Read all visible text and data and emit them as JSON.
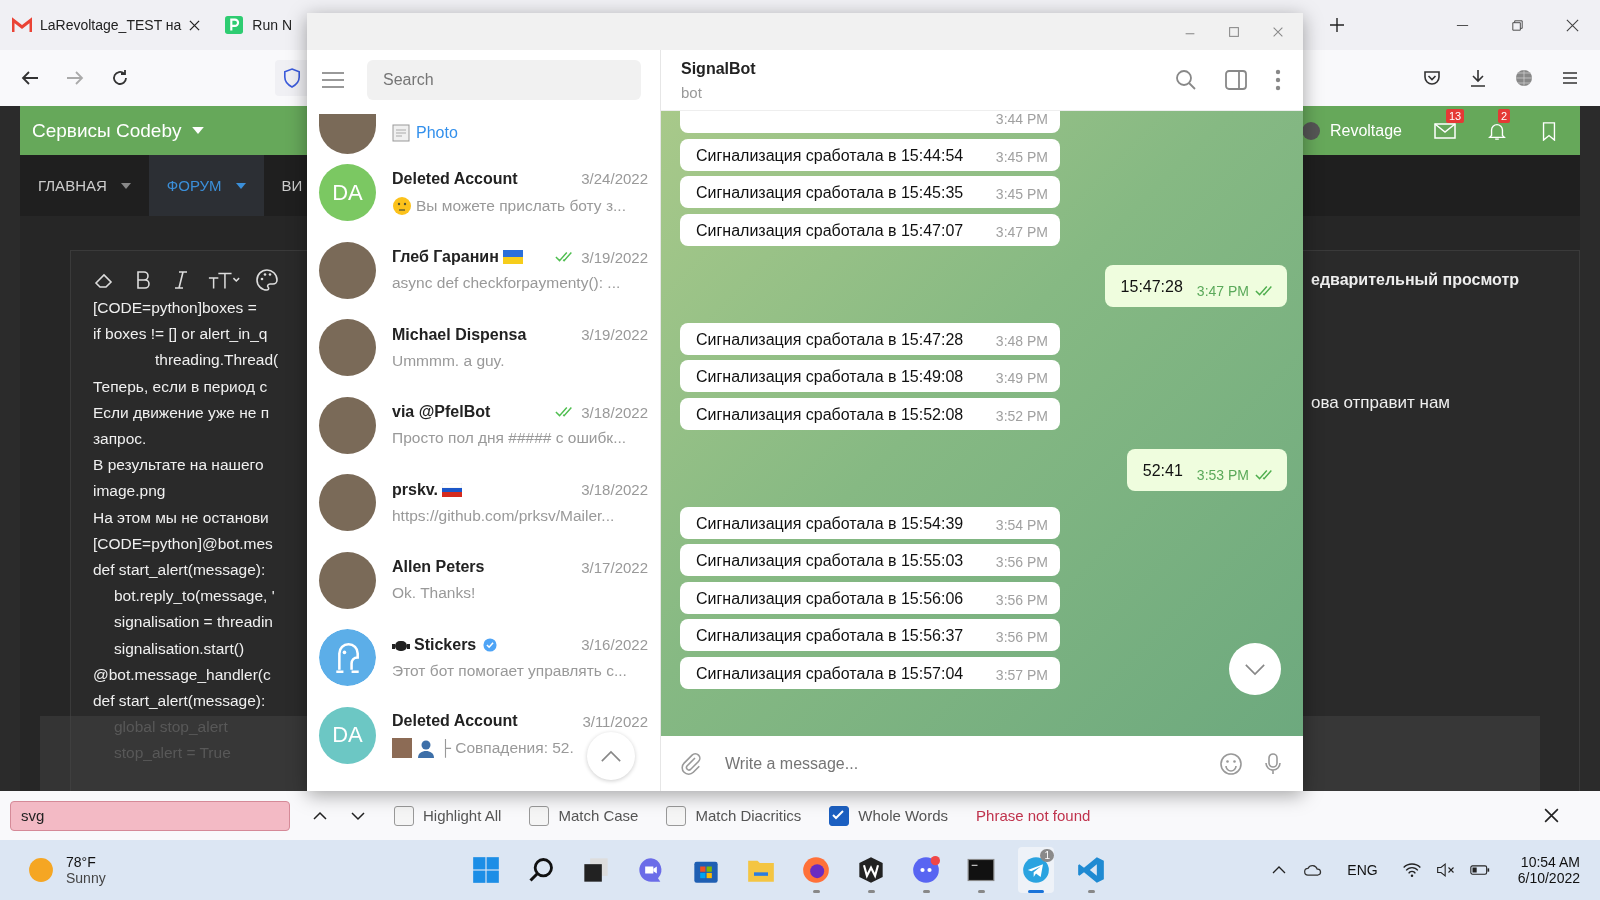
{
  "browser": {
    "tabs": [
      {
        "title": "LaRevoltage_TEST на",
        "kind": "mail"
      },
      {
        "title": "Run N",
        "kind": "p"
      }
    ]
  },
  "forum": {
    "menu_title": "Сервисы Codeby",
    "user": "Revoltage",
    "mail_badge": "13",
    "alert_badge": "2",
    "nav": [
      {
        "label": "ГЛАВНАЯ",
        "selected": false,
        "caret": true
      },
      {
        "label": "ФОРУМ",
        "selected": true,
        "caret": true
      },
      {
        "label": "ВИ",
        "selected": false,
        "caret": false
      }
    ],
    "editor_lines": [
      {
        "text": "[CODE=python]boxes =",
        "kind": "line"
      },
      {
        "text": "if boxes != [] or alert_in_q",
        "kind": "line"
      },
      {
        "text": "threading.Thread(",
        "kind": "deep"
      },
      {
        "text": "Теперь, если в период с",
        "kind": "line"
      },
      {
        "text": "Если движение уже не п",
        "kind": "line"
      },
      {
        "text": "запрос.",
        "kind": "line"
      },
      {
        "text": "В результате на нашего",
        "kind": "line"
      },
      {
        "text": "image.png",
        "kind": "line"
      },
      {
        "text": "На этом мы не останови",
        "kind": "line"
      },
      {
        "text": "[CODE=python]@bot.mes",
        "kind": "line"
      },
      {
        "text": "def start_alert(message):",
        "kind": "line"
      },
      {
        "text": "bot.reply_to(message, '",
        "kind": "indent"
      },
      {
        "text": "signalisation = threadin",
        "kind": "indent"
      },
      {
        "text": "signalisation.start()",
        "kind": "indent"
      },
      {
        "text": "@bot.message_handler(c",
        "kind": "line"
      },
      {
        "text": "def start_alert(message):",
        "kind": "line"
      },
      {
        "text": "global stop_alert",
        "kind": "faded"
      },
      {
        "text": "stop_alert = True",
        "kind": "faded"
      }
    ],
    "preview_label": "едварительный просмотр",
    "side_text": "ова отправит нам"
  },
  "telegram": {
    "search": {
      "placeholder": "Search"
    },
    "chats": [
      {
        "kind": "partial",
        "preview": "Photo",
        "avatar": {
          "kind": "photo"
        }
      },
      {
        "kind": "full",
        "name": "Deleted Account",
        "date": "3/24/2022",
        "preview": "Вы можете прислать боту з...",
        "preview_icon": {
          "kind": "emoji"
        },
        "read": false,
        "avatar": {
          "kind": "initials",
          "initials": "DA",
          "color": "#7bc862"
        }
      },
      {
        "kind": "full",
        "name": "Глеб Гаранин",
        "date": "3/19/2022",
        "preview": "async def checkforpaymenty():   ...",
        "read": true,
        "badge": {
          "kind": "ua"
        },
        "avatar": {
          "kind": "photo"
        }
      },
      {
        "kind": "full",
        "name": "Michael Dispensa",
        "date": "3/19/2022",
        "preview": "Ummmm.  a guy.",
        "read": false,
        "avatar": {
          "kind": "photo"
        }
      },
      {
        "kind": "full",
        "name": "via @PfelBot",
        "date": "3/18/2022",
        "preview": "Просто пол дня ##### с ошибк...",
        "read": true,
        "avatar": {
          "kind": "photo"
        }
      },
      {
        "kind": "full",
        "name": "prskv.",
        "date": "3/18/2022",
        "preview": "https://github.com/prksv/Mailer...",
        "read": false,
        "badge": {
          "kind": "ru"
        },
        "avatar": {
          "kind": "photo"
        }
      },
      {
        "kind": "full",
        "name": "Allen Peters",
        "date": "3/17/2022",
        "preview": "Ok.  Thanks!",
        "read": false,
        "avatar": {
          "kind": "photo"
        }
      },
      {
        "kind": "full",
        "name": "Stickers",
        "date": "3/16/2022",
        "preview": "Этот бот помогает управлять с...",
        "read": false,
        "badge": {
          "kind": "verified"
        },
        "avatar": {
          "kind": "icon",
          "color": "#5caee8"
        }
      },
      {
        "kind": "full",
        "name": "Deleted Account",
        "date": "3/11/2022",
        "preview": "├ Совпадения: 52.",
        "preview_icon": {
          "kind": "media"
        },
        "read": false,
        "avatar": {
          "kind": "initials",
          "initials": "DA",
          "color": "#6cc7c4"
        }
      }
    ],
    "chat": {
      "title": "SignalBot",
      "subtitle": "bot",
      "messages": [
        {
          "kind": "incoming-cut",
          "time": "3:44 PM"
        },
        {
          "kind": "incoming",
          "text": "Сигнализация сработала в 15:44:54",
          "time": "3:45 PM"
        },
        {
          "kind": "incoming",
          "text": "Сигнализация сработала в 15:45:35",
          "time": "3:45 PM"
        },
        {
          "kind": "incoming",
          "text": "Сигнализация сработала в 15:47:07",
          "time": "3:47 PM"
        },
        {
          "kind": "outgoing",
          "text": "15:47:28",
          "time": "3:47 PM",
          "read": true
        },
        {
          "kind": "incoming",
          "text": "Сигнализация сработала в 15:47:28",
          "time": "3:48 PM"
        },
        {
          "kind": "incoming",
          "text": "Сигнализация сработала в 15:49:08",
          "time": "3:49 PM"
        },
        {
          "kind": "incoming",
          "text": "Сигнализация сработала в 15:52:08",
          "time": "3:52 PM"
        },
        {
          "kind": "outgoing",
          "text": "52:41",
          "time": "3:53 PM",
          "read": true
        },
        {
          "kind": "incoming",
          "text": "Сигнализация сработала в 15:54:39",
          "time": "3:54 PM"
        },
        {
          "kind": "incoming",
          "text": "Сигнализация сработала в 15:55:03",
          "time": "3:56 PM"
        },
        {
          "kind": "incoming",
          "text": "Сигнализация сработала в 15:56:06",
          "time": "3:56 PM"
        },
        {
          "kind": "incoming",
          "text": "Сигнализация сработала в 15:56:37",
          "time": "3:56 PM"
        },
        {
          "kind": "incoming",
          "text": "Сигнализация сработала в 15:57:04",
          "time": "3:57 PM"
        }
      ],
      "composer": {
        "placeholder": "Write a message..."
      }
    }
  },
  "find_bar": {
    "query": "svg",
    "options": [
      {
        "label": "Highlight All",
        "checked": false
      },
      {
        "label": "Match Case",
        "checked": false
      },
      {
        "label": "Match Diacritics",
        "checked": false
      },
      {
        "label": "Whole Words",
        "checked": true
      }
    ],
    "status": "Phrase not found"
  },
  "taskbar": {
    "weather": {
      "temp": "78°F",
      "condition": "Sunny"
    },
    "apps": [
      {
        "kind": "start",
        "running": false,
        "active": false
      },
      {
        "kind": "search",
        "running": false,
        "active": false
      },
      {
        "kind": "taskview",
        "running": false,
        "active": false
      },
      {
        "kind": "chat",
        "running": false,
        "active": false
      },
      {
        "kind": "store",
        "running": false,
        "active": false
      },
      {
        "kind": "folder",
        "running": false,
        "active": false
      },
      {
        "kind": "firefox",
        "running": true,
        "active": false
      },
      {
        "kind": "w",
        "running": true,
        "active": false
      },
      {
        "kind": "discord",
        "running": true,
        "active": false
      },
      {
        "kind": "terminal",
        "running": true,
        "active": false
      },
      {
        "kind": "telegram",
        "running": true,
        "active": true,
        "badge": "1"
      },
      {
        "kind": "vscode",
        "running": true,
        "active": false
      }
    ],
    "language": "ENG",
    "time": "10:54 AM",
    "date": "6/10/2022"
  }
}
